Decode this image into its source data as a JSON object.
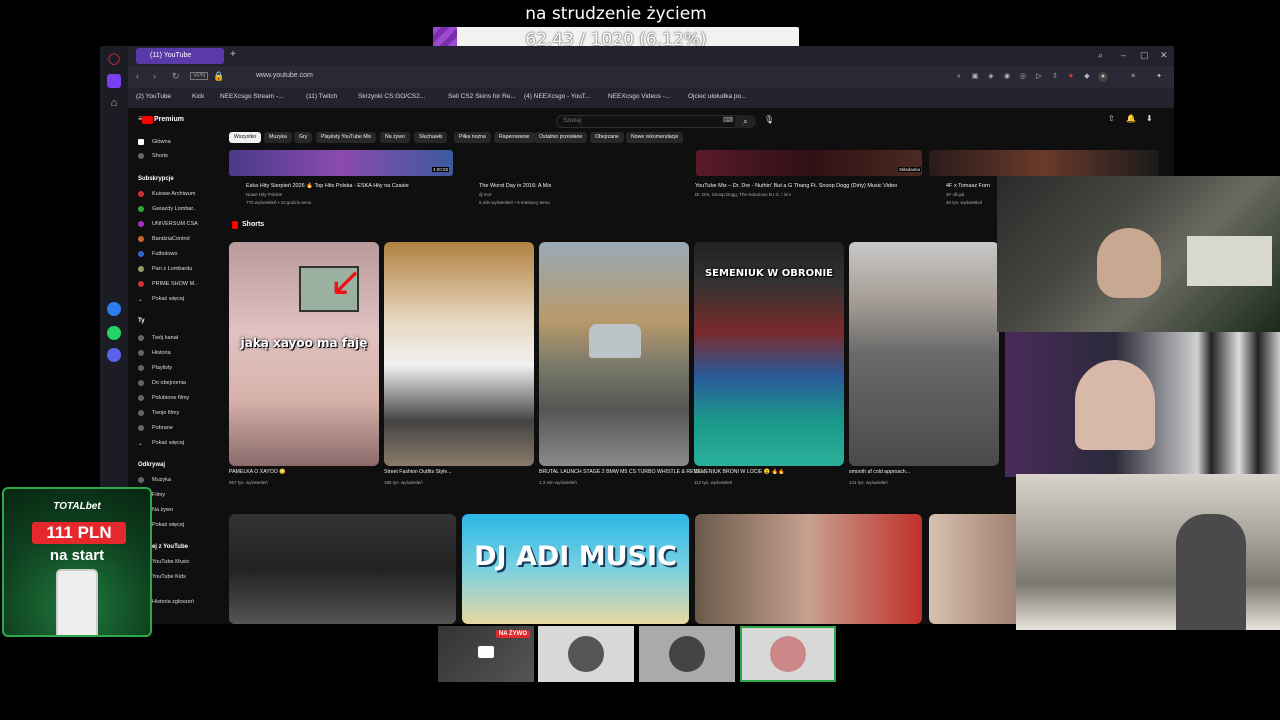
{
  "overlay": {
    "goal_title": "na strudzenie życiem",
    "goal_text": "62.43 / 1020 (6.12%)",
    "goal_progress": 0.0612,
    "goal_fill_color": "#9b4ccc"
  },
  "browser": {
    "active_tab": "(11) YouTube",
    "url": "www.youtube.com",
    "bookmarks": [
      "(2) YouTube",
      "Kick",
      "NEEXcsgo Stream -...",
      "(11) Twitch",
      "Skrzynki CS:GO/CS2...",
      "Sell CS2 Skins for Re...",
      "(4) NEEXcsgo - YouT...",
      "NEEXcsgo Videos -...",
      "Ojciec ułołudka po..."
    ]
  },
  "youtube": {
    "logo": "Premium",
    "search_placeholder": "Szukaj",
    "sidebar": {
      "home": "Główna",
      "shorts": "Shorts",
      "subs_header": "Subskrypcje",
      "subs": [
        "Kuiowe Archiwum",
        "Gwiazdy Lombar..",
        "UNIVERSUM CSA",
        "BandziaControl",
        "Futbolowo",
        "Pan z Lombardu",
        "PRIME SHOW M..",
        "Pokaż więcej"
      ],
      "you_header": "Ty",
      "you": [
        "Twój kanał",
        "Historia",
        "Playlisty",
        "Do obejrzenia",
        "Polubione filmy",
        "Twoje filmy",
        "Pobrane",
        "Pokaż więcej"
      ],
      "explore_header": "Odkrywaj",
      "explore": [
        "Muzyka",
        "Filmy",
        "Na żywo",
        "Pokaż więcej"
      ],
      "more_header": "Więcej z YouTube",
      "more": [
        "YouTube Music",
        "YouTube Kids"
      ],
      "bottom": "Historia zgłoszeń"
    },
    "chips": [
      "Wszystko",
      "Muzyka",
      "Gry",
      "Playlisty YouTube Mix",
      "Na żywo",
      "Słuchawki",
      "Piłka nożna",
      "Raperowanie",
      "Ostatnio przesłane",
      "Obejrzane",
      "Nowe rekomendacje"
    ],
    "top_videos": [
      {
        "title": "Eska Hity Sierpień 2026 🔥 Top Hits Polska - ESKA Hity na Czasie",
        "channel": "Nowe Hity Polskie",
        "meta": "770 wyświetleń • 10 godzin temu",
        "duration": "4:00:03"
      },
      {
        "title": "The Worst Day in 2016: A Mix",
        "channel": "dj mor",
        "meta": "5 mln wyświetleń • 8 miesięcy temu",
        "duration": ""
      },
      {
        "title": "YouTube Mix – Dr. Dre - Nuthin' But a G Thang Ft. Snoop Dogg (Dirty) Music Video",
        "channel": "Dr. Dre, Snoop Dogg, The Notorious B.I.G. i inni",
        "meta": "",
        "duration": "Składanka"
      },
      {
        "title": "4F x Tomasz Forn",
        "channel": "4F oficjal",
        "meta": "40 tys. wyświetleń",
        "duration": ""
      }
    ],
    "shorts_header": "Shorts",
    "shorts": [
      {
        "title": "PAMELKA O XAYOO 😳",
        "views": "957 tys. wyświetleń",
        "caption": "jaką xayoo ma faję"
      },
      {
        "title": "Street Fashion Outfits Style...",
        "views": "186 tys. wyświetleń",
        "caption": ""
      },
      {
        "title": "BRUTAL LAUNCH STAGE 2 BMW M5 CS TURBO WHISTLE & REVS...",
        "views": "1,3 mln wyświetleń",
        "caption": ""
      },
      {
        "title": "SEMENIUK BRONI W LOCIE 😮 🔥🔥",
        "views": "112 tys. wyświetleń",
        "caption": "SEMENIUK W OBRONIE"
      },
      {
        "title": "smooth af cold approach...",
        "views": "141 tys. wyświetleń",
        "caption": ""
      }
    ],
    "row2": [
      {
        "caption": ""
      },
      {
        "caption": "DJ ADI MUSIC"
      },
      {
        "caption": ""
      },
      {
        "caption": ""
      }
    ]
  },
  "bet_widget": {
    "logo": "TOTALbet",
    "amount": "111 PLN",
    "subtitle": "na start"
  },
  "bottom_bar": {
    "live_badge": "NA ŻYWO"
  }
}
